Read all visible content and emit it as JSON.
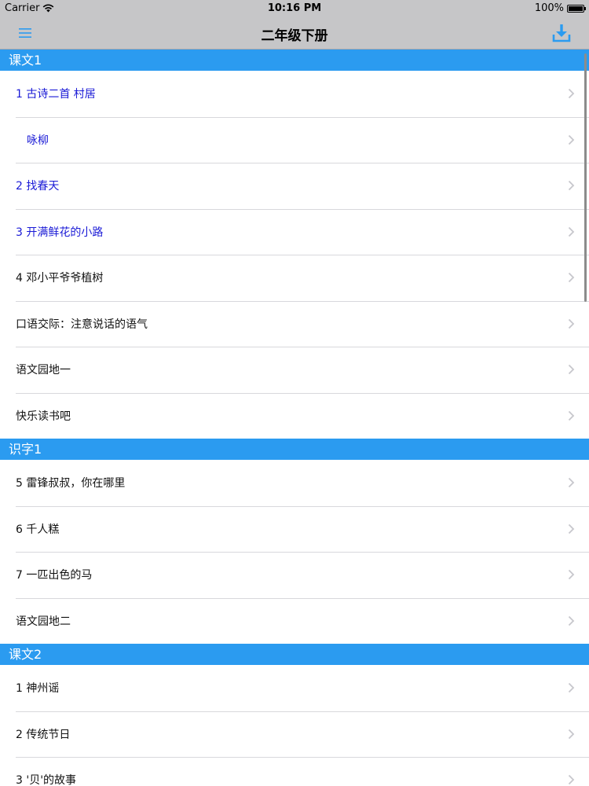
{
  "status_bar": {
    "carrier": "Carrier",
    "time": "10:16 PM",
    "battery": "100%",
    "battery_level": 1.0
  },
  "nav": {
    "title": "二年级下册",
    "menu_icon": "hamburger-menu-icon",
    "download_icon": "download-icon"
  },
  "colors": {
    "accent": "#2b9bf0",
    "highlight_text": "#1a1ad6",
    "nav_bg": "#c6c6c8"
  },
  "sections": [
    {
      "header": "课文1",
      "rows": [
        {
          "label": "1   古诗二首    村居",
          "highlight": true,
          "indent": false
        },
        {
          "label": "咏柳",
          "highlight": true,
          "indent": true
        },
        {
          "label": "2   找春天",
          "highlight": true,
          "indent": false
        },
        {
          "label": "3   开满鲜花的小路",
          "highlight": true,
          "indent": false
        },
        {
          "label": "4   邓小平爷爷植树",
          "highlight": false,
          "indent": false
        },
        {
          "label": "口语交际：注意说话的语气",
          "highlight": false,
          "indent": false
        },
        {
          "label": "语文园地一",
          "highlight": false,
          "indent": false
        },
        {
          "label": "快乐读书吧",
          "highlight": false,
          "indent": false
        }
      ]
    },
    {
      "header": "识字1",
      "rows": [
        {
          "label": "5   雷锋叔叔，你在哪里",
          "highlight": false,
          "indent": false
        },
        {
          "label": "6   千人糕",
          "highlight": false,
          "indent": false
        },
        {
          "label": "7   一匹出色的马",
          "highlight": false,
          "indent": false
        },
        {
          "label": "语文园地二",
          "highlight": false,
          "indent": false
        }
      ]
    },
    {
      "header": "课文2",
      "rows": [
        {
          "label": "1   神州谣",
          "highlight": false,
          "indent": false
        },
        {
          "label": "2   传统节日",
          "highlight": false,
          "indent": false
        },
        {
          "label": "3   '贝'的故事",
          "highlight": false,
          "indent": false
        }
      ]
    }
  ]
}
